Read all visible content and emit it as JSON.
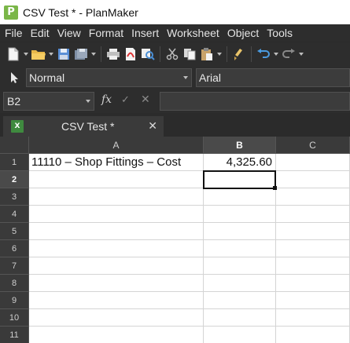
{
  "window": {
    "title": "CSV Test * - PlanMaker",
    "app_icon_letter": "P"
  },
  "menu": [
    "File",
    "Edit",
    "View",
    "Format",
    "Insert",
    "Worksheet",
    "Object",
    "Tools"
  ],
  "toolbar": {
    "icons": [
      "new-document-icon",
      "open-folder-icon",
      "save-icon",
      "save-all-icon",
      "print-icon",
      "export-pdf-icon",
      "print-preview-icon",
      "cut-icon",
      "copy-icon",
      "paste-icon",
      "format-painter-icon",
      "undo-icon",
      "redo-icon"
    ]
  },
  "format_bar": {
    "style_value": "Normal",
    "font_value": "Arial"
  },
  "edit_line": {
    "cell_reference": "B2",
    "fx_label": "fx",
    "confirm_glyph": "✓",
    "cancel_glyph": "✕",
    "formula_value": ""
  },
  "tabs": [
    {
      "label": "CSV Test *",
      "icon_text": "X",
      "close_glyph": "✕"
    }
  ],
  "sheet": {
    "columns": [
      "A",
      "B",
      "C"
    ],
    "rows": [
      "1",
      "2",
      "3",
      "4",
      "5",
      "6",
      "7",
      "8",
      "9",
      "10",
      "11"
    ],
    "active_cell": "B2",
    "cells": {
      "A1": "11110 – Shop Fittings – Cost",
      "B1": "4,325.60"
    }
  },
  "colors": {
    "app_icon": "#7ab648",
    "chrome_background": "#2d2d2d",
    "header_background": "#3a3a3a"
  }
}
